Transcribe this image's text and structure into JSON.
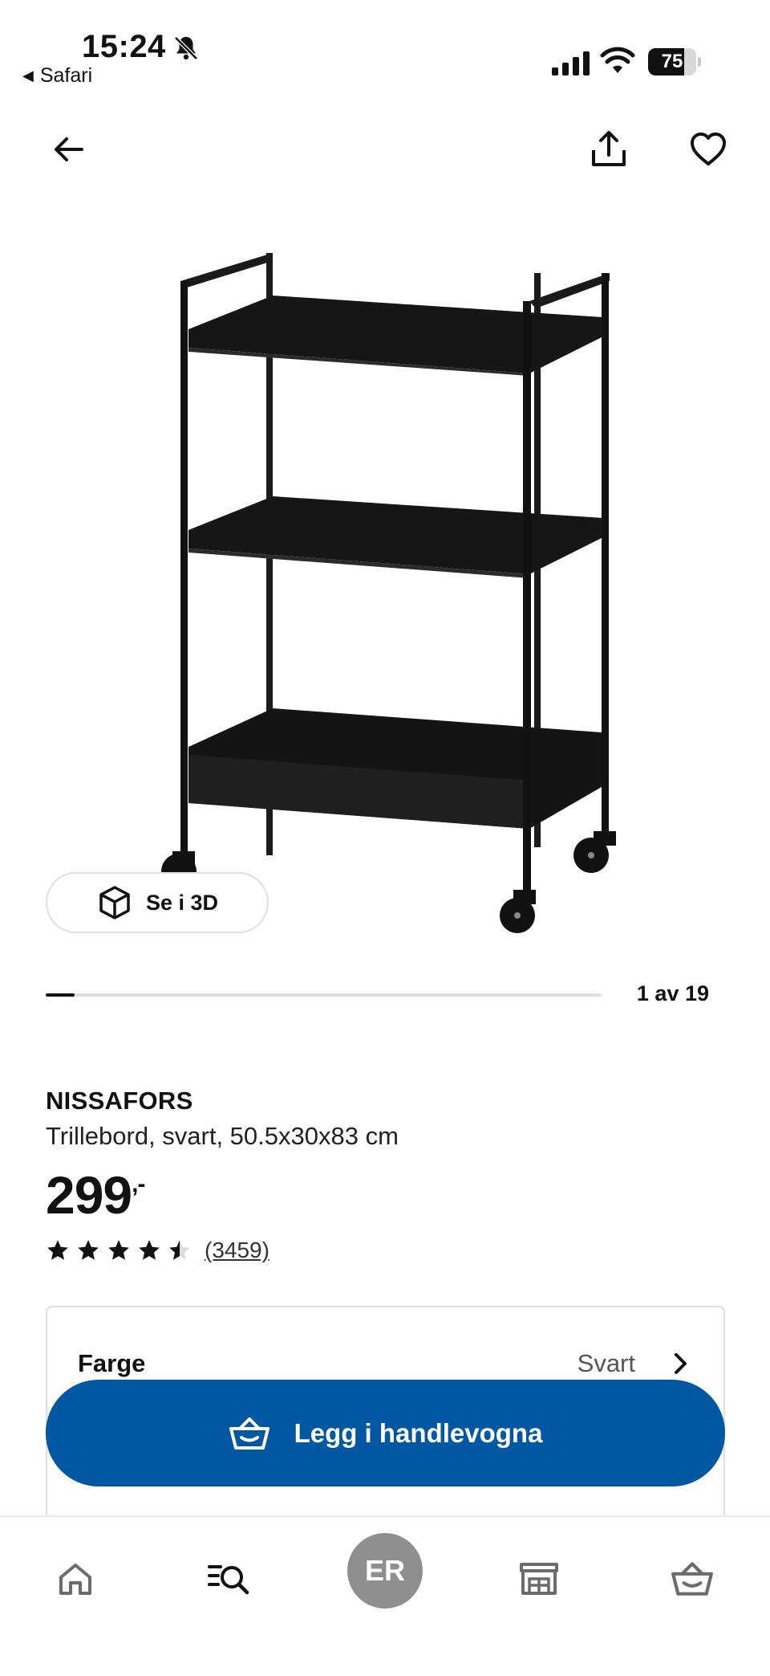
{
  "status_bar": {
    "time": "15:24",
    "back_app": "Safari",
    "battery": "75",
    "battery_level": 0.75
  },
  "nav": {
    "back_icon": "arrow-left-icon",
    "share_icon": "share-icon",
    "favorite_icon": "heart-icon"
  },
  "gallery": {
    "view_3d_label": "Se i 3D",
    "counter": "1 av 19",
    "current": 1,
    "total": 19
  },
  "product": {
    "name": "NISSAFORS",
    "description": "Trillebord, svart, 50.5x30x83 cm",
    "price": "299",
    "price_suffix": ",-",
    "rating_value": 4.5,
    "rating_count": "(3459)"
  },
  "color_option": {
    "label": "Farge",
    "value": "Svart"
  },
  "cart_button": {
    "label": "Legg i handlevogna"
  },
  "tab_bar": {
    "avatar_initials": "ER",
    "items": [
      "home-icon",
      "search-list-icon",
      "avatar",
      "store-icon",
      "cart-icon"
    ]
  },
  "colors": {
    "accent": "#0058a3",
    "avatar_bg": "#8f8f8f"
  }
}
